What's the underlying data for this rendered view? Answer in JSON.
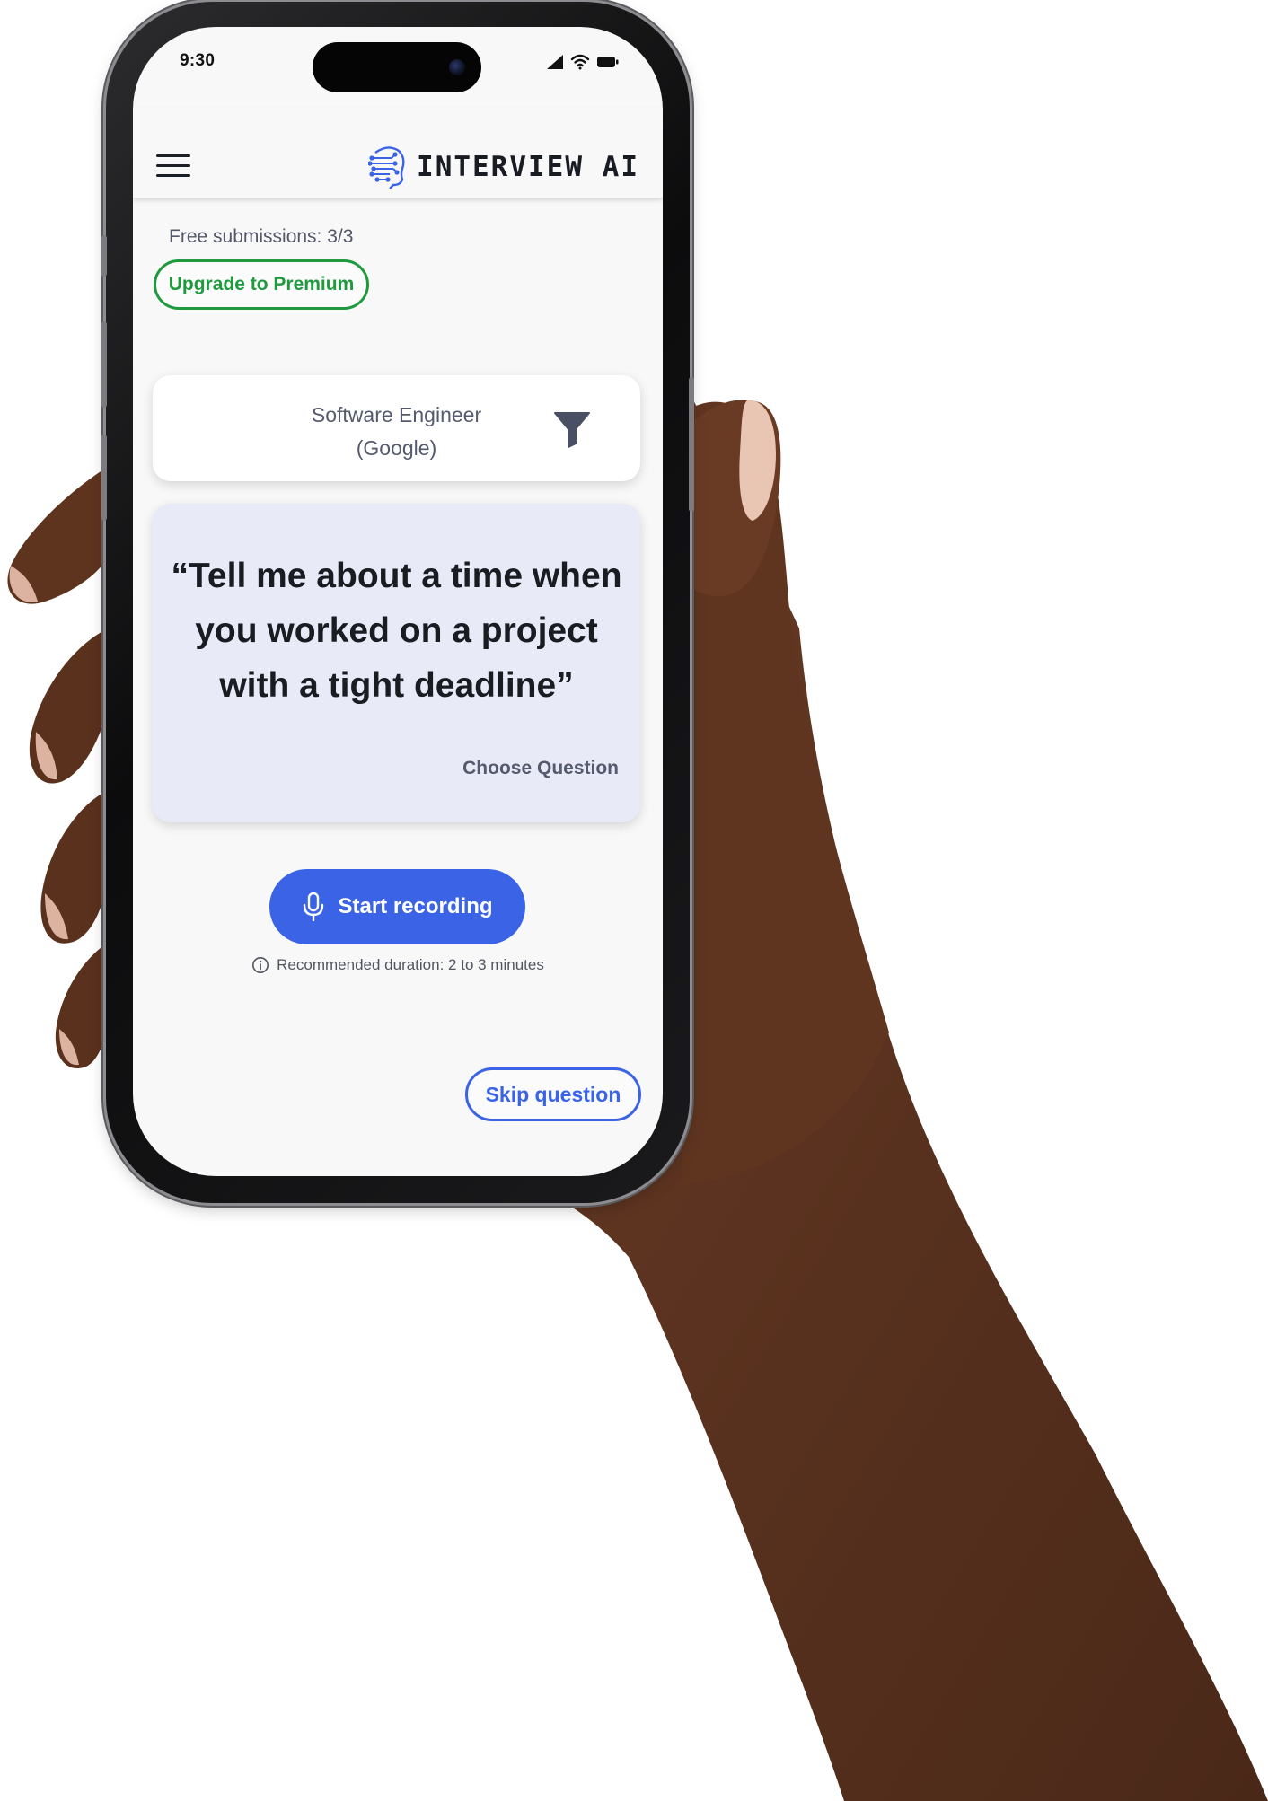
{
  "status_bar": {
    "time": "9:30"
  },
  "header": {
    "brand": "INTERVIEW AI",
    "menu_icon": "hamburger-menu-icon",
    "logo_icon": "circuit-brain-icon",
    "accent": "#3a63e6"
  },
  "subscription": {
    "free_submissions": "Free submissions: 3/3",
    "upgrade_label": "Upgrade to Premium",
    "upgrade_color": "#1f9a3e"
  },
  "role": {
    "title": "Software Engineer",
    "company": "(Google)",
    "filter_icon": "filter-funnel-icon"
  },
  "question": {
    "text": "“Tell me about a time when you worked on a project with a tight deadline”",
    "choose_label": "Choose Question",
    "background": "#e8ebf7"
  },
  "recording": {
    "button_label": "Start recording",
    "icon": "microphone-icon",
    "info_icon": "info-circle-icon",
    "duration_hint": "Recommended duration: 2 to 3 minutes"
  },
  "actions": {
    "skip_label": "Skip question"
  }
}
